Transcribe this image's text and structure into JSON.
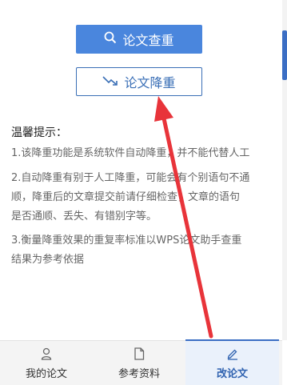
{
  "actions": {
    "check_label": "论文查重",
    "reduce_label": "论文降重"
  },
  "tips": {
    "title": "温馨提示：",
    "item1": "1.该降重功能是系统软件自动降重，并不能代替人工",
    "item2_line1": "2.自动降重有别于人工降重，可能会有个别语句不通",
    "item2_line2": "顺，降重后的文章提交前请仔细检查，文章的语句",
    "item2_line3": "是否通顺、丢失、有错别字等。",
    "item3_line1": "3.衡量降重效果的重复率标准以WPS论文助手查重",
    "item3_line2": "结果为参考依据"
  },
  "tabbar": {
    "tabs": [
      {
        "label": "我的论文",
        "icon": "user-icon"
      },
      {
        "label": "参考资料",
        "icon": "document-icon"
      },
      {
        "label": "改论文",
        "icon": "edit-icon"
      }
    ],
    "active_index": 2
  },
  "colors": {
    "primary": "#4a86dd",
    "accent": "#3a6fb6",
    "arrow": "#e8343a"
  }
}
